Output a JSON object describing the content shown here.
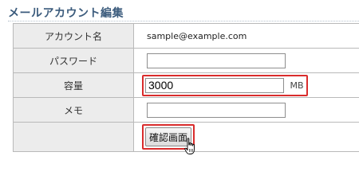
{
  "page": {
    "title": "メールアカウント編集"
  },
  "form": {
    "account": {
      "label": "アカウント名",
      "value": "sample@example.com"
    },
    "password": {
      "label": "パスワード",
      "value": ""
    },
    "quota": {
      "label": "容量",
      "value": "3000",
      "unit": "MB"
    },
    "memo": {
      "label": "メモ",
      "value": ""
    },
    "confirm_button_label": "確認画面"
  },
  "colors": {
    "title": "#3b5b7c",
    "highlight": "#d92c2c",
    "label_background": "#ececec"
  },
  "icons": {
    "pointer": "hand-pointer-icon"
  }
}
